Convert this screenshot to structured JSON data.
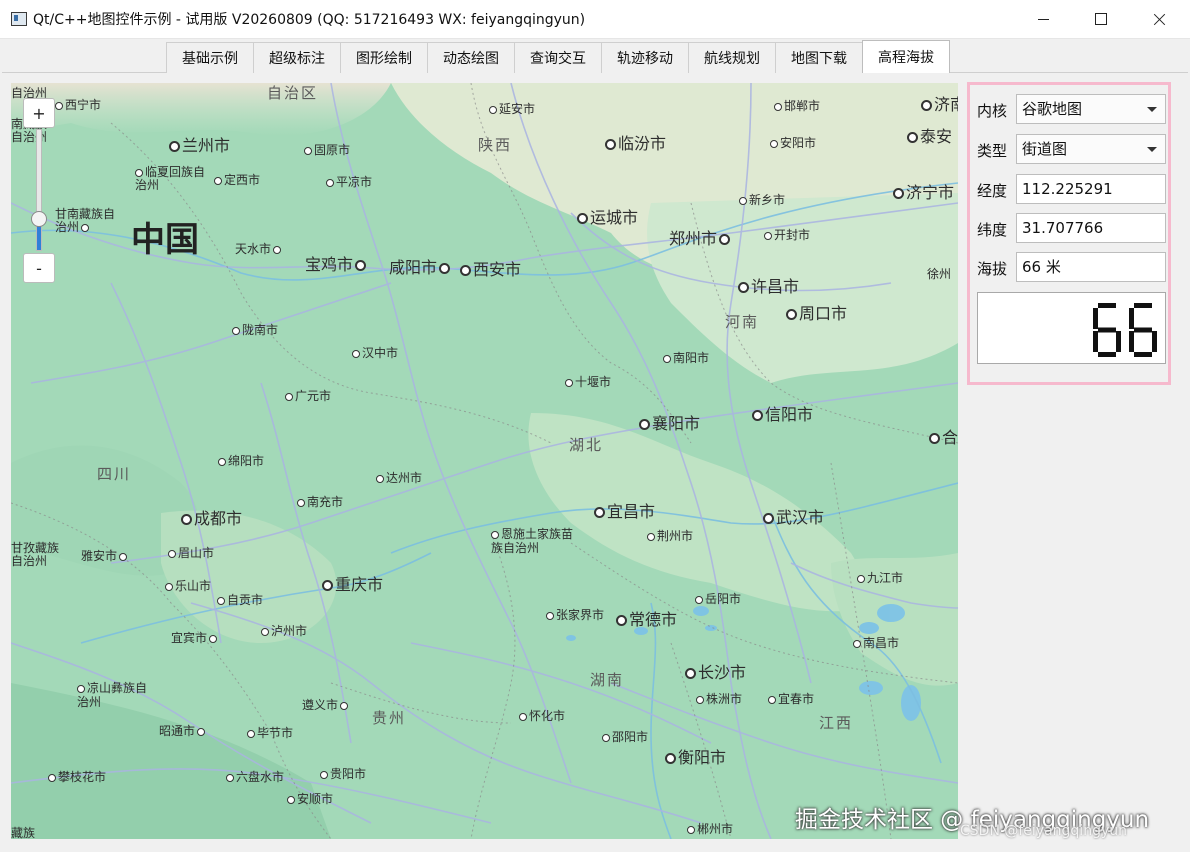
{
  "window": {
    "title": "Qt/C++地图控件示例 - 试用版 V20260809 (QQ: 517216493 WX: feiyangqingyun)"
  },
  "tabs": [
    {
      "label": "基础示例",
      "active": false
    },
    {
      "label": "超级标注",
      "active": false
    },
    {
      "label": "图形绘制",
      "active": false
    },
    {
      "label": "动态绘图",
      "active": false
    },
    {
      "label": "查询交互",
      "active": false
    },
    {
      "label": "轨迹移动",
      "active": false
    },
    {
      "label": "航线规划",
      "active": false
    },
    {
      "label": "地图下载",
      "active": false
    },
    {
      "label": "高程海拔",
      "active": true
    }
  ],
  "map": {
    "zoom_in_label": "+",
    "zoom_out_label": "-",
    "zoom_level_fraction": 0.25,
    "country_label": "中国",
    "provinces": [
      "自治区",
      "陕西",
      "河南",
      "湖北",
      "四川",
      "湖南",
      "贵州",
      "江西"
    ],
    "cities": [
      "西宁市",
      "兰州市",
      "临夏回族自治州",
      "定西市",
      "固原市",
      "平凉市",
      "甘南藏族自治州",
      "天水市",
      "宝鸡市",
      "咸阳市",
      "西安市",
      "延安市",
      "临汾市",
      "运城市",
      "郑州市",
      "开封市",
      "新乡市",
      "安阳市",
      "邯郸市",
      "许昌市",
      "周口市",
      "南阳市",
      "十堰市",
      "汉中市",
      "陇南市",
      "广元市",
      "襄阳市",
      "信阳市",
      "绵阳市",
      "达州市",
      "南充市",
      "成都市",
      "宜昌市",
      "荆州市",
      "武汉市",
      "恩施土家族苗族自治州",
      "雅安市",
      "眉山市",
      "乐山市",
      "自贡市",
      "重庆市",
      "泸州市",
      "宜宾市",
      "张家界市",
      "常德市",
      "岳阳市",
      "九江市",
      "长沙市",
      "株洲市",
      "宜春市",
      "南昌市",
      "凉山彝族自治州",
      "遵义市",
      "毕节市",
      "昭通市",
      "怀化市",
      "邵阳市",
      "衡阳市",
      "攀枝花市",
      "六盘水市",
      "贵阳市",
      "安顺市",
      "郴州市",
      "济南",
      "泰安",
      "济宁市",
      "徐州",
      "合肥",
      "甘孜藏族自治州"
    ],
    "edge_labels": [
      "自治州",
      "南藏族",
      "自治州",
      "藏族"
    ],
    "tile_colors": {
      "land": "#a3d9b8",
      "forest": "#8fcfa6",
      "plain": "#c8e6c9",
      "north": "#e8e3d3",
      "road": "#b3b9e6",
      "water": "#7ec3e6"
    }
  },
  "panel": {
    "core_label": "内核",
    "core_value": "谷歌地图",
    "type_label": "类型",
    "type_value": "街道图",
    "lng_label": "经度",
    "lng_value": "112.225291",
    "lat_label": "纬度",
    "lat_value": "31.707766",
    "alt_label": "海拔",
    "alt_value": "66 米",
    "lcd_value": "66",
    "border_color": "#f6b9cd"
  },
  "watermark": {
    "main": "掘金技术社区 @ feiyangqingyun",
    "sub": "CSDN @feiyangqingyun"
  }
}
